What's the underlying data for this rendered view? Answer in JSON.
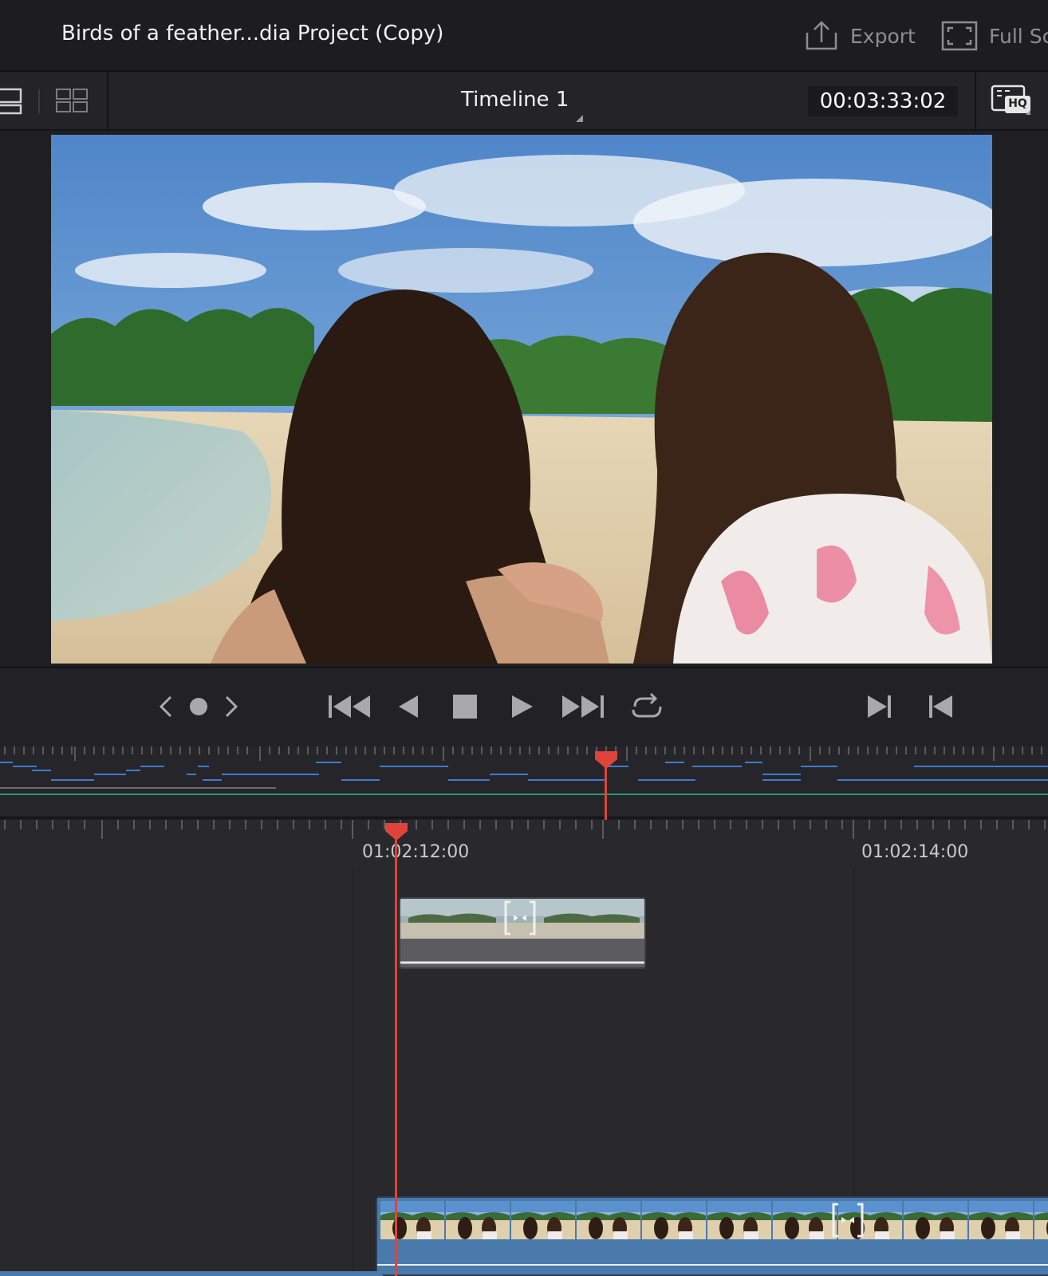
{
  "header": {
    "project_title": "Birds of a feather...dia Project (Copy)",
    "export_label": "Export",
    "fullscreen_label": "Full Sc"
  },
  "viewer": {
    "timeline_name": "Timeline 1",
    "timecode": "00:03:33:02",
    "hq_label": "HQ"
  },
  "timeline": {
    "ruler_labels": [
      "01:02:12:00",
      "01:02:14:00"
    ]
  },
  "colors": {
    "accent_playhead": "#e0433a",
    "video_clip": "#4a7aab",
    "audio_clip": "#5c5c60"
  }
}
